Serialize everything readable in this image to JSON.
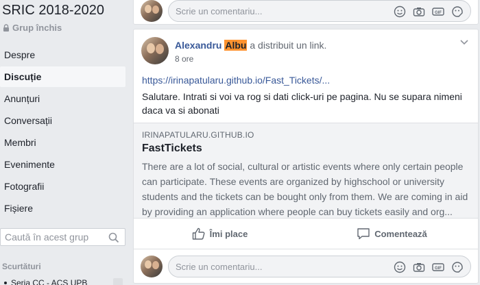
{
  "group": {
    "title": "SRIC 2018-2020",
    "privacy": "Grup închis"
  },
  "nav": [
    {
      "label": "Despre",
      "active": false
    },
    {
      "label": "Discuție",
      "active": true
    },
    {
      "label": "Anunțuri",
      "active": false
    },
    {
      "label": "Conversații",
      "active": false
    },
    {
      "label": "Membri",
      "active": false
    },
    {
      "label": "Evenimente",
      "active": false
    },
    {
      "label": "Fotografii",
      "active": false
    },
    {
      "label": "Fișiere",
      "active": false
    }
  ],
  "search": {
    "placeholder": "Caută în acest grup"
  },
  "shortcuts": {
    "heading": "Scurtături",
    "first_item": "Seria CC - ACS UPB"
  },
  "comment_placeholder": "Scrie un comentariu...",
  "post": {
    "author_first": "Alexandru",
    "author_last": "Albu",
    "action": "a distribuit un link.",
    "time": "8 ore",
    "link": "https://irinapatularu.github.io/Fast_Tickets/...",
    "text": "Salutare. Intrati si voi va rog si dati click-uri pe pagina. Nu se supara nimeni daca va si abonati",
    "preview": {
      "domain": "IRINAPATULARU.GITHUB.IO",
      "title": "FastTickets",
      "description": "There are a lot of social, cultural or artistic events where only certain people can participate. These events are organized by highschool or university students and the tickets can be bought only from them. We are coming in aid by providing an application where people can buy tickets easily and org..."
    },
    "like_label": "Îmi place",
    "comment_label": "Comentează"
  },
  "colors": {
    "link_blue": "#385898",
    "highlight": "#ff9330",
    "background": "#e9ebee"
  }
}
